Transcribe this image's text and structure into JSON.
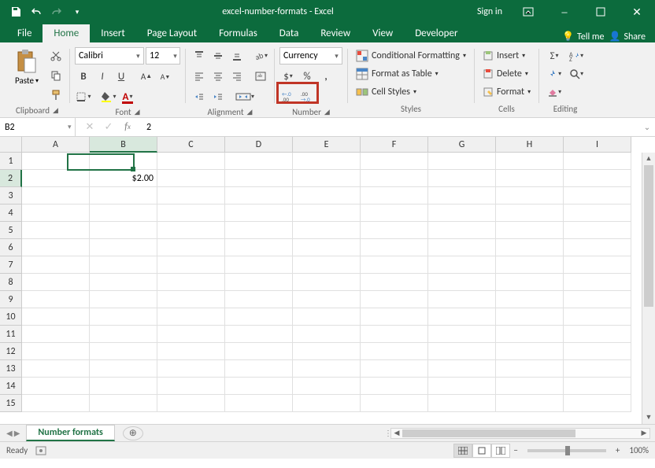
{
  "titlebar": {
    "title": "excel-number-formats - Excel",
    "signin": "Sign in"
  },
  "tabs": {
    "file": "File",
    "home": "Home",
    "insert": "Insert",
    "page_layout": "Page Layout",
    "formulas": "Formulas",
    "data": "Data",
    "review": "Review",
    "view": "View",
    "developer": "Developer",
    "tell_me": "Tell me",
    "share": "Share"
  },
  "ribbon": {
    "clipboard": {
      "label": "Clipboard",
      "paste": "Paste"
    },
    "font": {
      "label": "Font",
      "font_name": "Calibri",
      "font_size": "12"
    },
    "alignment": {
      "label": "Alignment"
    },
    "number": {
      "label": "Number",
      "format": "Currency",
      "currency_symbol": "$",
      "percent_symbol": "%",
      "comma_symbol": ","
    },
    "styles": {
      "label": "Styles",
      "cond_fmt": "Conditional Formatting",
      "table": "Format as Table",
      "cell_styles": "Cell Styles"
    },
    "cells": {
      "label": "Cells",
      "insert": "Insert",
      "delete": "Delete",
      "format": "Format"
    },
    "editing": {
      "label": "Editing"
    }
  },
  "namebox": {
    "value": "B2"
  },
  "formula": {
    "value": "2"
  },
  "grid": {
    "columns": [
      "A",
      "B",
      "C",
      "D",
      "E",
      "F",
      "G",
      "H",
      "I"
    ],
    "rows": [
      "1",
      "2",
      "3",
      "4",
      "5",
      "6",
      "7",
      "8",
      "9",
      "10",
      "11",
      "12",
      "13",
      "14",
      "15"
    ],
    "active_col": 1,
    "active_row": 1,
    "cells": {
      "B2": "$2.00"
    }
  },
  "sheets": {
    "active": "Number formats"
  },
  "status": {
    "ready": "Ready",
    "zoom": "100%"
  }
}
